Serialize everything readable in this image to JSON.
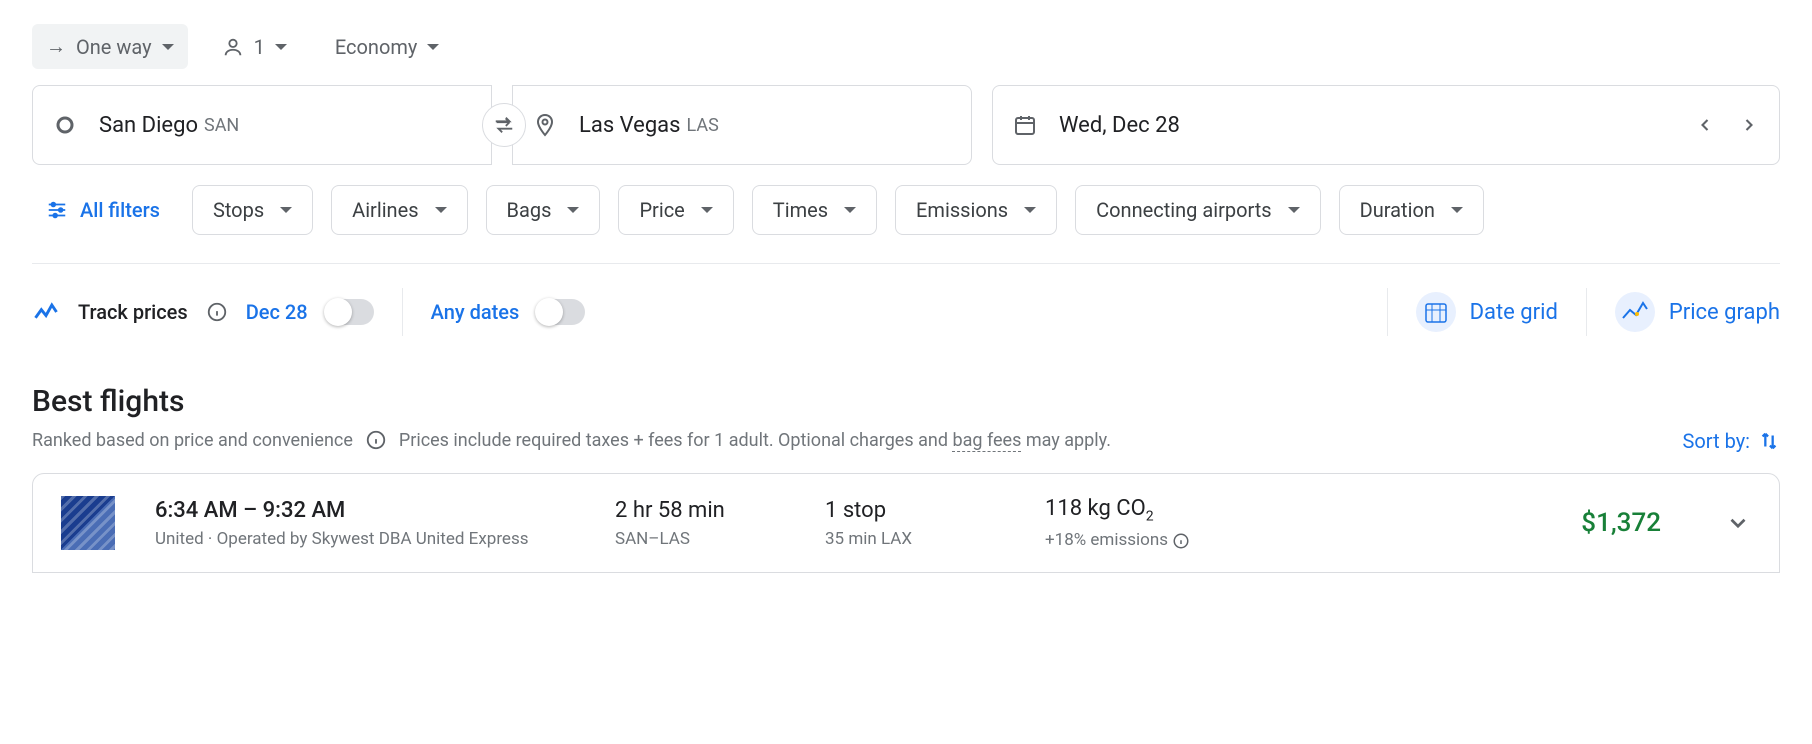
{
  "top": {
    "trip_type": "One way",
    "passengers": "1",
    "cabin": "Economy"
  },
  "search": {
    "origin_city": "San Diego",
    "origin_code": "SAN",
    "dest_city": "Las Vegas",
    "dest_code": "LAS",
    "date": "Wed, Dec 28"
  },
  "filters": {
    "all": "All filters",
    "chips": [
      "Stops",
      "Airlines",
      "Bags",
      "Price",
      "Times",
      "Emissions",
      "Connecting airports",
      "Duration"
    ]
  },
  "track": {
    "label": "Track prices",
    "date": "Dec 28",
    "any_dates": "Any dates"
  },
  "tools": {
    "date_grid": "Date grid",
    "price_graph": "Price graph"
  },
  "section": {
    "title": "Best flights",
    "sub_a": "Ranked based on price and convenience",
    "sub_b": "Prices include required taxes + fees for 1 adult. Optional charges and ",
    "bag_fees": "bag fees",
    "sub_c": " may apply.",
    "sort_by": "Sort by:"
  },
  "flight": {
    "times": "6:34 AM – 9:32 AM",
    "operator": "United · Operated by Skywest DBA United Express",
    "duration": "2 hr 58 min",
    "route": "SAN–LAS",
    "stops": "1 stop",
    "layover": "35 min LAX",
    "emissions": "118 kg CO",
    "emissions_sub": "2",
    "emissions_pct": "+18% emissions",
    "price": "$1,372"
  }
}
